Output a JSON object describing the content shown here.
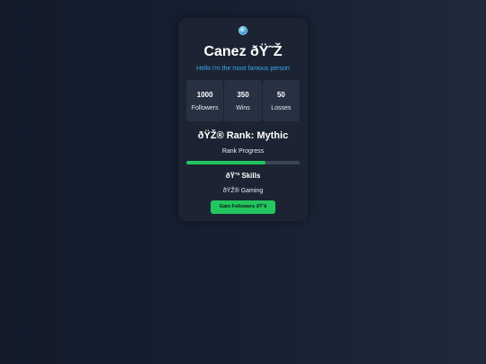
{
  "profile": {
    "name": "Canez ðŸ˜Ž",
    "bio": "Hello i'm the most famous person"
  },
  "stats": [
    {
      "value": "1000",
      "label": "Followers"
    },
    {
      "value": "350",
      "label": "Wins"
    },
    {
      "value": "50",
      "label": "Losses"
    }
  ],
  "rank": {
    "title": "ðŸŽ® Rank: Mythic",
    "progress_label": "Rank Progress",
    "progress_percent": 70
  },
  "skills": {
    "title": "ðŸ’ª Skills",
    "items": [
      "ðŸŽ® Gaming"
    ]
  },
  "actions": {
    "gain_label": "Gain Followers ðŸ’¥"
  },
  "colors": {
    "accent": "#22c55e",
    "bio_text": "#3da8f5",
    "card_bg": "#1c2433",
    "stat_bg": "#273142"
  }
}
